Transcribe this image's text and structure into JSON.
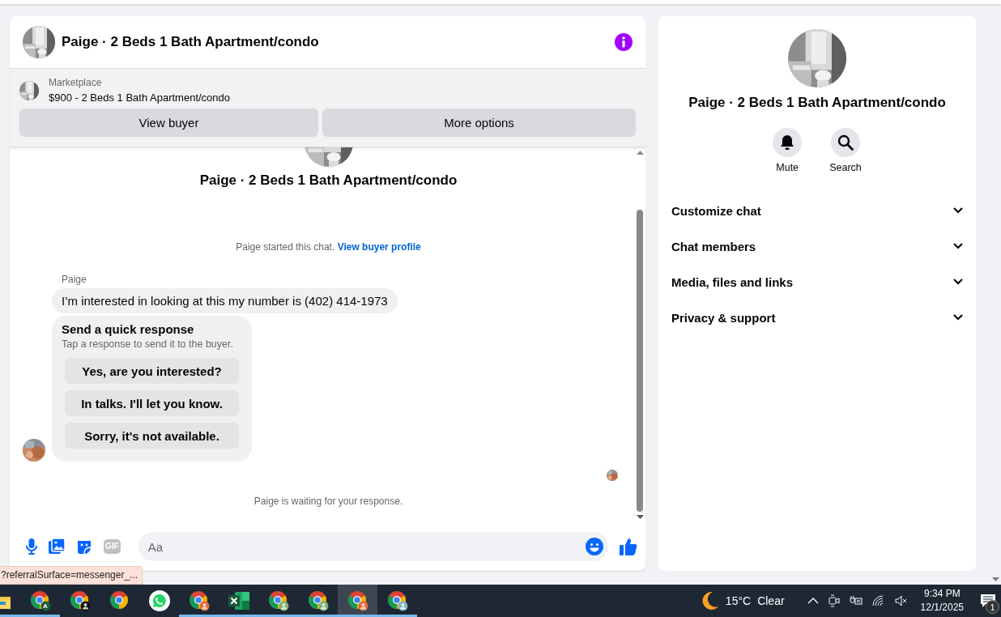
{
  "chat": {
    "title": "Paige · 2 Beds 1 Bath Apartment/condo",
    "listing": {
      "source": "Marketplace",
      "title": "$900 - 2 Beds 1 Bath Apartment/condo",
      "buttons": [
        "View buyer",
        "More options"
      ]
    },
    "thread": {
      "title": "Paige · 2 Beds 1 Bath Apartment/condo",
      "notice": "Paige started this chat.",
      "notice_link": "View buyer profile",
      "sender": "Paige",
      "message": "I’m interested in looking at this my number is (402) 414-1973",
      "quick_response": {
        "title": "Send a quick response",
        "subtitle": "Tap a response to send it to the buyer.",
        "options": [
          "Yes, are you interested?",
          "In talks. I'll let you know.",
          "Sorry, it's not available."
        ]
      },
      "status": "Paige is waiting for your response."
    },
    "composer": {
      "gif": "GIF",
      "placeholder": "Aa"
    }
  },
  "info_panel": {
    "title": "Paige · 2 Beds 1 Bath Apartment/condo",
    "actions": [
      {
        "kind": "mute",
        "label": "Mute"
      },
      {
        "kind": "search",
        "label": "Search"
      }
    ],
    "sections": [
      {
        "label": "Customize chat",
        "expanded": false
      },
      {
        "label": "Chat members",
        "expanded": false
      },
      {
        "label": "Media, files and links",
        "expanded": false
      },
      {
        "label": "Privacy & support",
        "expanded": false
      }
    ]
  },
  "link_preview": "?referralSurface=messenger_...",
  "taskbar": {
    "apps": [
      {
        "kind": "folder",
        "running": true,
        "selected": false
      },
      {
        "kind": "chrome",
        "badge": "A",
        "color": "#1e5b3f",
        "running": true,
        "selected": false
      },
      {
        "kind": "chrome",
        "color": "#111111",
        "running": false,
        "selected": false
      },
      {
        "kind": "chrome",
        "running": false,
        "selected": false
      },
      {
        "kind": "whatsapp",
        "running": false,
        "selected": false
      },
      {
        "kind": "chrome",
        "color": "#e8673c",
        "running": true,
        "selected": false
      },
      {
        "kind": "excel",
        "running": true,
        "selected": false
      },
      {
        "kind": "chrome",
        "color": "#7fb07a",
        "running": true,
        "selected": false
      },
      {
        "kind": "chrome",
        "color": "#7fb07a",
        "running": true,
        "selected": false
      },
      {
        "kind": "chrome",
        "color": "#e8673c",
        "running": true,
        "selected": true
      },
      {
        "kind": "chrome",
        "color": "#7fb3c4",
        "running": true,
        "selected": false
      }
    ],
    "temperature": "15°C",
    "weather": "Clear",
    "time": "9:34 PM",
    "date": "12/1/2025",
    "notifications": "1"
  }
}
